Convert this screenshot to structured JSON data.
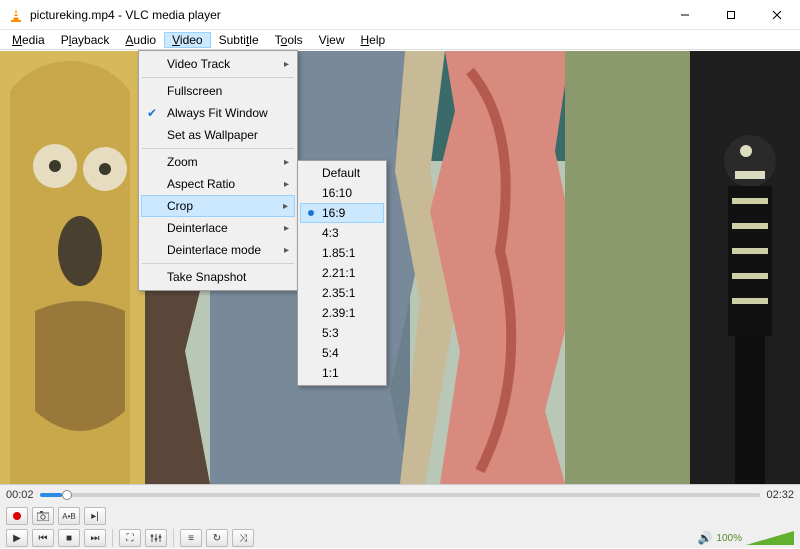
{
  "titlebar": {
    "filename": "pictureking.mp4",
    "separator": " - ",
    "appname": "VLC media player"
  },
  "menubar": {
    "items": [
      {
        "label": "Media",
        "hot": "M"
      },
      {
        "label": "Playback",
        "hot": "l"
      },
      {
        "label": "Audio",
        "hot": "A"
      },
      {
        "label": "Video",
        "hot": "V",
        "open": true
      },
      {
        "label": "Subtitle",
        "hot": "S"
      },
      {
        "label": "Tools",
        "hot": "T"
      },
      {
        "label": "View",
        "hot": "V"
      },
      {
        "label": "Help",
        "hot": "H"
      }
    ]
  },
  "video_menu": {
    "video_track": "Video Track",
    "fullscreen": "Fullscreen",
    "always_fit": "Always Fit Window",
    "set_wallpaper": "Set as Wallpaper",
    "zoom": "Zoom",
    "aspect_ratio": "Aspect Ratio",
    "crop": "Crop",
    "deinterlace": "Deinterlace",
    "deinterlace_mode": "Deinterlace mode",
    "take_snapshot": "Take Snapshot",
    "always_fit_checked": true,
    "crop_open": true
  },
  "crop_menu": {
    "options": [
      "Default",
      "16:10",
      "16:9",
      "4:3",
      "1.85:1",
      "2.21:1",
      "2.35:1",
      "2.39:1",
      "5:3",
      "5:4",
      "1:1"
    ],
    "selected": "16:9"
  },
  "playback": {
    "current_time": "00:02",
    "total_time": "02:32"
  },
  "volume": {
    "percent": "100%"
  },
  "icons": {
    "play": "▶",
    "stop": "■",
    "prev": "⏮",
    "next": "⏭",
    "fullscreen": "⛶",
    "playlist": "≡",
    "loop": "↻",
    "shuffle": "⤨",
    "camera": "📷",
    "atob": "A-B",
    "frame": "⏭",
    "speaker": "🔊",
    "min": "—",
    "max": "☐",
    "close": "✕"
  }
}
